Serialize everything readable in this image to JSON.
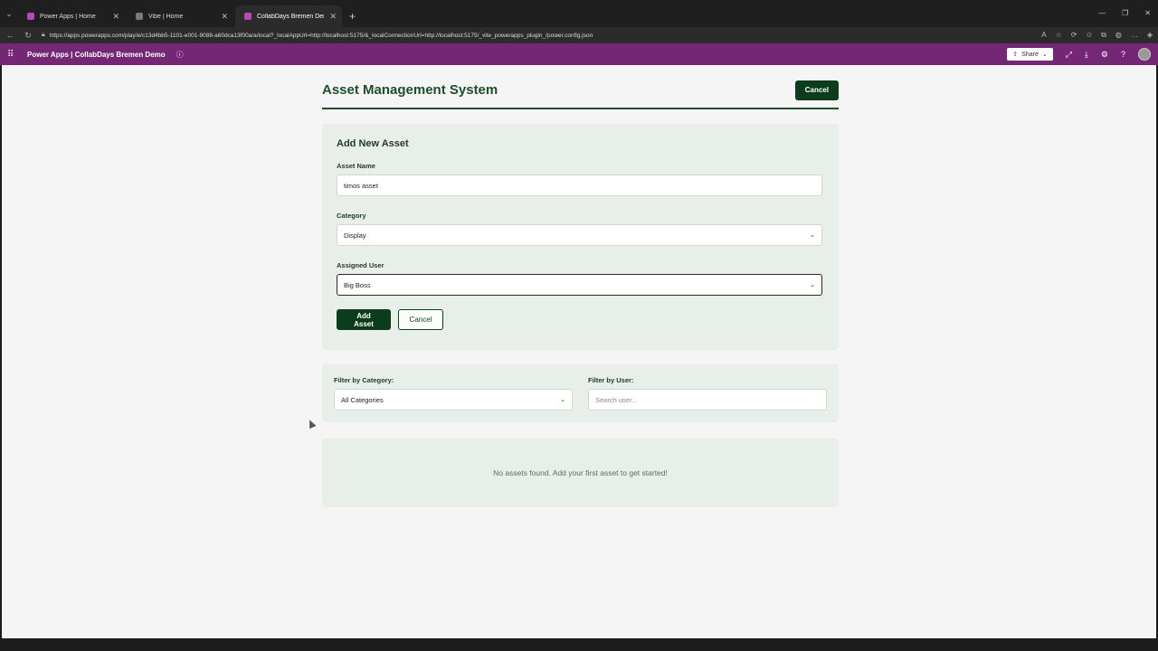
{
  "browser": {
    "tabs": [
      {
        "title": "Power Apps | Home",
        "color": "#b44ab4"
      },
      {
        "title": "Vibe | Home",
        "color": "#7a7a7a"
      },
      {
        "title": "CollabDays Bremen Demo - Pow",
        "color": "#b44ab4"
      }
    ],
    "active_tab": 2,
    "url": "https://apps.powerapps.com/play/e/c13d4bb5-1101-e001-9088-a60dca13f00a/a/local?_localAppUrl=http://localhost:5175/&_localConnectionUrl=http://localhost:5175/_vite_powerapps_plugin_/power.config.json"
  },
  "appbar": {
    "title": "Power Apps  |  CollabDays Bremen Demo",
    "share_label": "Share"
  },
  "page": {
    "title": "Asset Management System",
    "cancel_label": "Cancel"
  },
  "form": {
    "title": "Add New Asset",
    "asset_name_label": "Asset Name",
    "asset_name_value": "timos asset",
    "category_label": "Category",
    "category_value": "Display",
    "user_label": "Assigned User",
    "user_value": "Big Boss",
    "add_label": "Add Asset",
    "cancel_label": "Cancel"
  },
  "filters": {
    "category_label": "Filter by Category:",
    "category_value": "All Categories",
    "user_label": "Filter by User:",
    "user_placeholder": "Search user..."
  },
  "empty_message": "No assets found. Add your first asset to get started!",
  "colors": {
    "appbar": "#742774",
    "primary": "#0b3d1c",
    "card": "#e8efe9"
  }
}
